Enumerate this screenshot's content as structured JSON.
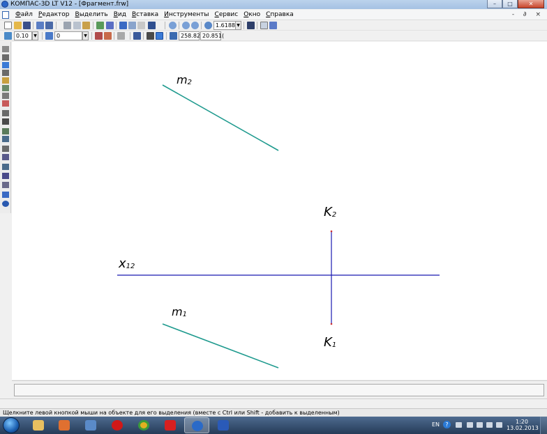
{
  "window": {
    "title": "КОМПАС-3D LT V12 - [Фрагмент.frw]",
    "min_glyph": "–",
    "max_glyph": "□",
    "close_glyph": "✕"
  },
  "menu": {
    "items": [
      "Файл",
      "Редактор",
      "Выделить",
      "Вид",
      "Вставка",
      "Инструменты",
      "Сервис",
      "Окно",
      "Справка"
    ],
    "mdi_controls": "- ∂ ×"
  },
  "toolbar": {
    "zoom_value": "1.6188"
  },
  "props_toolbar": {
    "step_value": "0.10",
    "layer_value": "0",
    "coord_x": "258.82",
    "coord_y": "20.851("
  },
  "drawing": {
    "labels": {
      "m2_main": "m",
      "m2_sub": "2",
      "m1_main": "m",
      "m1_sub": "1",
      "k2_main": "K",
      "k2_sub": "2",
      "k1_main": "K",
      "k1_sub": "1",
      "x12_main": "x",
      "x12_sub": "12"
    },
    "colors": {
      "segment": "#1e9a8e",
      "axis": "#1818b0",
      "point": "#d03030"
    }
  },
  "status": {
    "hint": "Щелкните левой кнопкой мыши на объекте для его выделения (вместе с Ctrl или Shift - добавить к выделенным)"
  },
  "taskbar": {
    "language": "EN",
    "help_glyph": "?",
    "time": "1:20",
    "date": "13.02.2013",
    "apps": [
      "explorer",
      "media-player",
      "mail",
      "opera",
      "chrome",
      "yandex",
      "kompas",
      "word"
    ]
  }
}
